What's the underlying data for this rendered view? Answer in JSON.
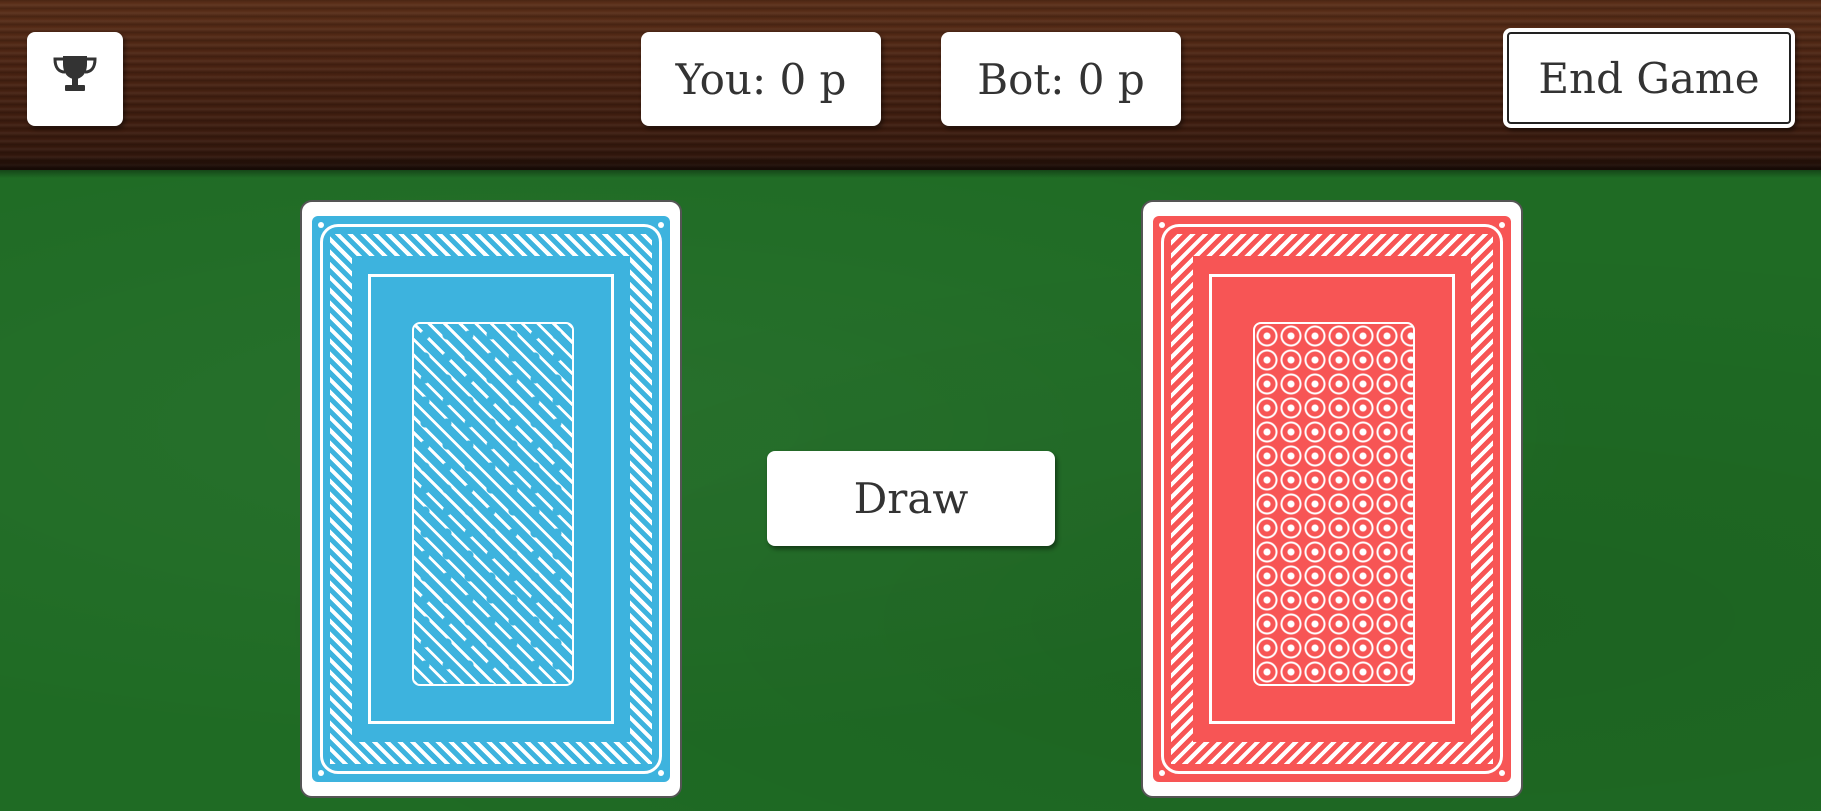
{
  "header": {
    "trophy_icon": "trophy-icon",
    "score_you": "You: 0 p",
    "score_bot": "Bot: 0 p",
    "end_game_label": "End Game"
  },
  "table": {
    "draw_label": "Draw",
    "player_card_color": "#3db3de",
    "bot_card_color": "#f75555"
  },
  "colors": {
    "felt": "#1f6b24",
    "wood": "#4a2312"
  }
}
